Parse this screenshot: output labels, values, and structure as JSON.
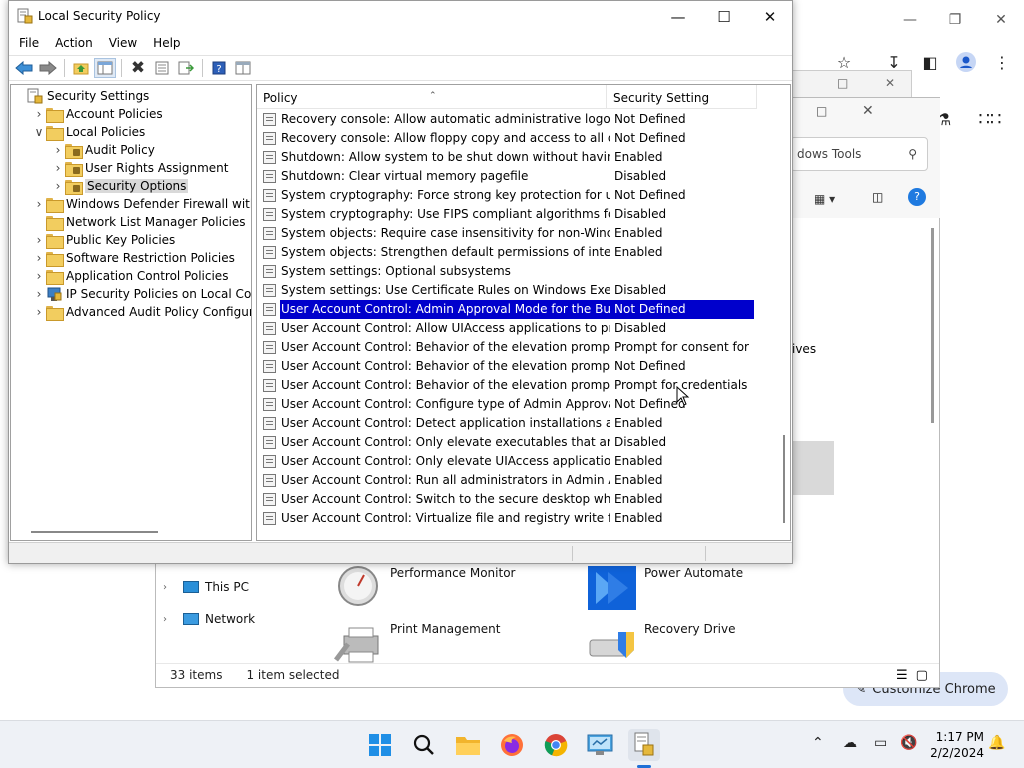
{
  "lsp": {
    "title": "Local Security Policy",
    "menu": [
      "File",
      "Action",
      "View",
      "Help"
    ],
    "tree": [
      {
        "label": "Security Settings",
        "indent": 0,
        "arrow": "",
        "icon": "security-settings"
      },
      {
        "label": "Account Policies",
        "indent": 1,
        "arrow": "right",
        "icon": "folder"
      },
      {
        "label": "Local Policies",
        "indent": 1,
        "arrow": "down",
        "icon": "folder"
      },
      {
        "label": "Audit Policy",
        "indent": 2,
        "arrow": "right",
        "icon": "folder-lock"
      },
      {
        "label": "User Rights Assignment",
        "indent": 2,
        "arrow": "right",
        "icon": "folder-lock"
      },
      {
        "label": "Security Options",
        "indent": 2,
        "arrow": "right",
        "icon": "folder-lock",
        "selected": true
      },
      {
        "label": "Windows Defender Firewall with Adva",
        "indent": 1,
        "arrow": "right",
        "icon": "folder"
      },
      {
        "label": "Network List Manager Policies",
        "indent": 1,
        "arrow": "",
        "icon": "folder"
      },
      {
        "label": "Public Key Policies",
        "indent": 1,
        "arrow": "right",
        "icon": "folder"
      },
      {
        "label": "Software Restriction Policies",
        "indent": 1,
        "arrow": "right",
        "icon": "folder"
      },
      {
        "label": "Application Control Policies",
        "indent": 1,
        "arrow": "right",
        "icon": "folder"
      },
      {
        "label": "IP Security Policies on Local Compute",
        "indent": 1,
        "arrow": "right",
        "icon": "ip-security"
      },
      {
        "label": "Advanced Audit Policy Configuration",
        "indent": 1,
        "arrow": "right",
        "icon": "folder"
      }
    ],
    "columns": {
      "policy": "Policy",
      "setting": "Security Setting"
    },
    "rows": [
      {
        "policy": "Recovery console: Allow automatic administrative logon",
        "setting": "Not Defined"
      },
      {
        "policy": "Recovery console: Allow floppy copy and access to all drives...",
        "setting": "Not Defined"
      },
      {
        "policy": "Shutdown: Allow system to be shut down without having to...",
        "setting": "Enabled"
      },
      {
        "policy": "Shutdown: Clear virtual memory pagefile",
        "setting": "Disabled"
      },
      {
        "policy": "System cryptography: Force strong key protection for user k...",
        "setting": "Not Defined"
      },
      {
        "policy": "System cryptography: Use FIPS compliant algorithms for en...",
        "setting": "Disabled"
      },
      {
        "policy": "System objects: Require case insensitivity for non-Windows ...",
        "setting": "Enabled"
      },
      {
        "policy": "System objects: Strengthen default permissions of internal s...",
        "setting": "Enabled"
      },
      {
        "policy": "System settings: Optional subsystems",
        "setting": ""
      },
      {
        "policy": "System settings: Use Certificate Rules on Windows Executabl...",
        "setting": "Disabled"
      },
      {
        "policy": "User Account Control: Admin Approval Mode for the Built-i...",
        "setting": "Not Defined",
        "selected": true
      },
      {
        "policy": "User Account Control: Allow UIAccess applications to prom...",
        "setting": "Disabled"
      },
      {
        "policy": "User Account Control: Behavior of the elevation prompt for ...",
        "setting": "Prompt for consent for ..."
      },
      {
        "policy": "User Account Control: Behavior of the elevation prompt for ...",
        "setting": "Not Defined"
      },
      {
        "policy": "User Account Control: Behavior of the elevation prompt for ...",
        "setting": "Prompt for credentials"
      },
      {
        "policy": "User Account Control: Configure type of Admin Approval M...",
        "setting": "Not Defined"
      },
      {
        "policy": "User Account Control: Detect application installations and p...",
        "setting": "Enabled"
      },
      {
        "policy": "User Account Control: Only elevate executables that are sign...",
        "setting": "Disabled"
      },
      {
        "policy": "User Account Control: Only elevate UIAccess applications th...",
        "setting": "Enabled"
      },
      {
        "policy": "User Account Control: Run all administrators in Admin Appr...",
        "setting": "Enabled"
      },
      {
        "policy": "User Account Control: Switch to the secure desktop when pr...",
        "setting": "Enabled"
      },
      {
        "policy": "User Account Control: Virtualize file and registry write failure...",
        "setting": "Enabled"
      }
    ]
  },
  "windows_tools": {
    "search_placeholder": "dows Tools",
    "partial_text": "ives",
    "nav": [
      {
        "label": "This PC",
        "icon": "pc-icon"
      },
      {
        "label": "Network",
        "icon": "network-icon"
      }
    ],
    "tiles": [
      {
        "label": "Performance Monitor",
        "icon": "performance-monitor-icon"
      },
      {
        "label": "Power Automate",
        "icon": "power-automate-icon"
      },
      {
        "label": "Print Management",
        "icon": "print-management-icon"
      },
      {
        "label": "Recovery Drive",
        "icon": "recovery-drive-icon"
      }
    ],
    "status": {
      "items": "33 items",
      "selected": "1 item selected"
    }
  },
  "chrome": {
    "customize_label": "Customize Chrome"
  },
  "taskbar": {
    "time": "1:17 PM",
    "date": "2/2/2024",
    "apps": [
      "start-icon",
      "search-icon",
      "file-explorer-icon",
      "firefox-icon",
      "chrome-icon",
      "control-panel-icon",
      "local-security-policy-icon"
    ]
  },
  "colors": {
    "selection": "#0000cc",
    "taskbar_bg": "#eef1f6",
    "folder": "#f2cd5f"
  }
}
